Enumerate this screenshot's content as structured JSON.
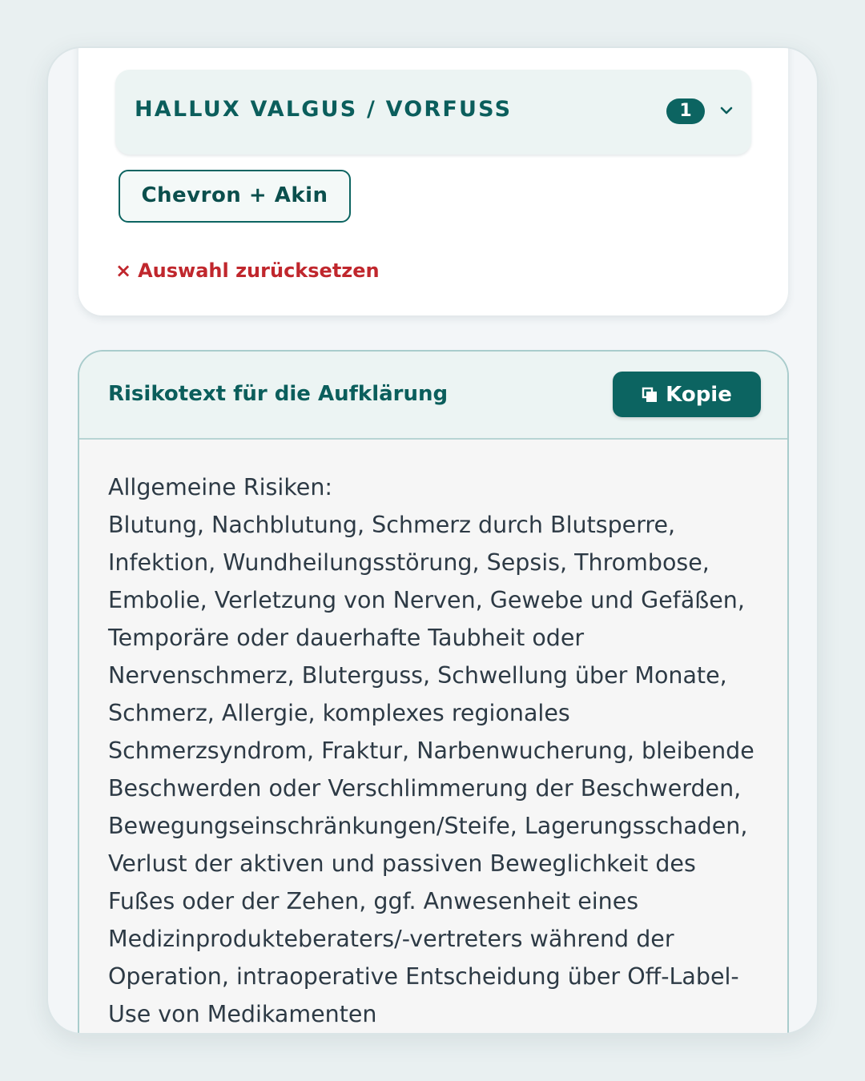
{
  "category": {
    "title": "HALLUX VALGUS / VORFUSS",
    "count": "1",
    "chevron_icon": "chevron-down-icon"
  },
  "selection": {
    "option_label": "Chevron + Akin",
    "reset_icon": "×",
    "reset_label": "Auswahl zurücksetzen"
  },
  "risk_text": {
    "title": "Risikotext für die Aufklärung",
    "copy_icon": "copy-icon",
    "copy_label": "Kopie",
    "content": "Allgemeine Risiken:\nBlutung, Nachblutung, Schmerz durch Blutsperre, Infektion, Wundheilungsstörung, Sepsis, Thrombose, Embolie, Verletzung von Nerven, Gewebe und Gefäßen, Temporäre oder dauerhafte Taubheit oder Nervenschmerz, Bluterguss, Schwellung über Monate, Schmerz, Allergie, komplexes regionales Schmerzsyndrom, Fraktur, Narbenwucherung, bleibende Beschwerden oder Verschlimmerung der Beschwerden, Bewegungseinschränkungen/Steife, Lagerungsschaden, Verlust der aktiven und passiven Beweglichkeit des Fußes oder der Zehen, ggf. Anwesenheit eines Medizinprodukteberaters/-vertreters während der Operation, intraoperative Entscheidung über Off-Label-Use von Medikamenten"
  },
  "colors": {
    "accent": "#0c6461",
    "danger": "#c0272d",
    "text": "#2d3a45"
  }
}
